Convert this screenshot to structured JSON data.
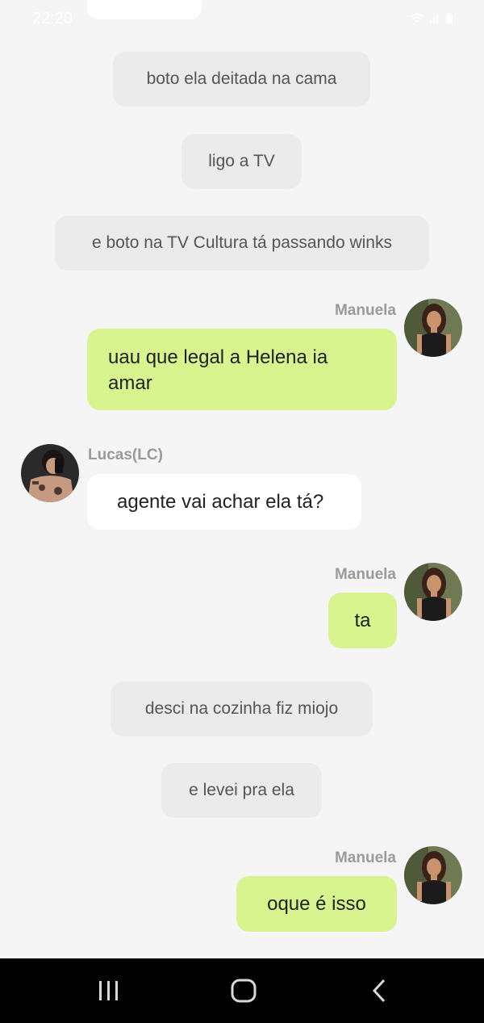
{
  "status": {
    "time": "22:20"
  },
  "narration": [
    "boto ela deitada na cama",
    "ligo a TV",
    "e boto na TV Cultura tá passando winks",
    "desci na cozinha fiz miojo",
    "e levei pra ela"
  ],
  "messages": [
    {
      "sender": "Manuela",
      "text": "uau que legal a Helena ia amar"
    },
    {
      "sender": "Lucas(LC)",
      "text": "agente vai achar ela tá?"
    },
    {
      "sender": "Manuela",
      "text": "ta"
    },
    {
      "sender": "Manuela",
      "text": "oque é isso"
    }
  ],
  "colors": {
    "background": "#f5f5f5",
    "narration_bubble": "#ebebeb",
    "own_bubble": "#d7f48f",
    "other_bubble": "#ffffff",
    "nav_bar": "#000000"
  },
  "icons": {
    "status": [
      "wifi-icon",
      "signal-icon",
      "battery-icon"
    ],
    "nav": [
      "recent-apps-icon",
      "home-icon",
      "back-icon"
    ]
  }
}
